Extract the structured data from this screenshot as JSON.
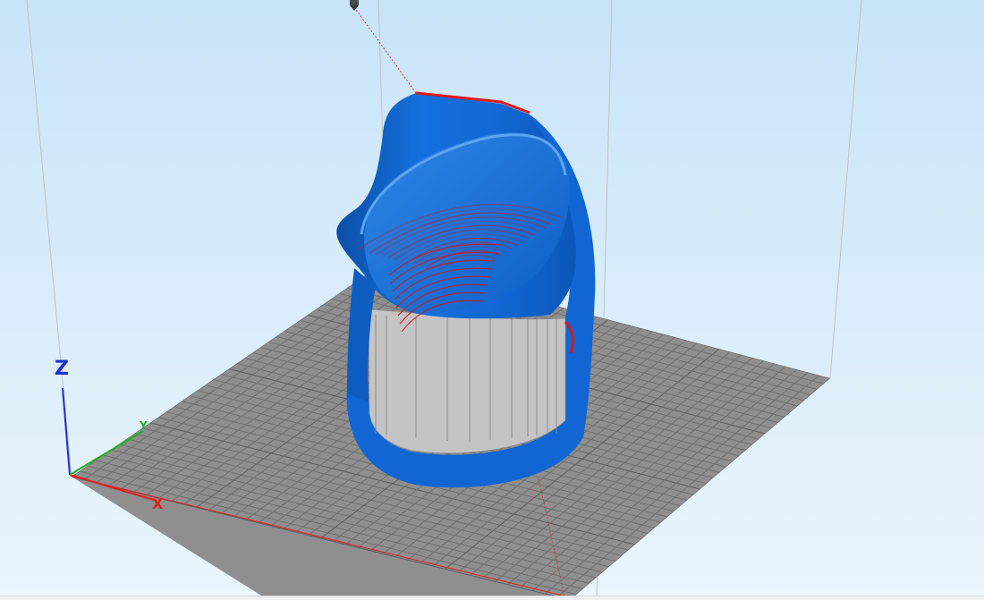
{
  "viewport": {
    "background_top": "#c8e4f8",
    "background_bottom": "#eaf5fc",
    "bed_color": "#8f8f8f",
    "grid_color": "#6e6e6e",
    "frame_line_color": "#bfbfbf",
    "print_color": "#1166d3",
    "print_shadow_color": "#0b4fa8",
    "highlight_color": "#e01818",
    "support_color": "#c4c4c4"
  },
  "axes": {
    "x": {
      "label": "X",
      "color": "#e02020"
    },
    "y": {
      "label": "Y",
      "color": "#20b020"
    },
    "z": {
      "label": "Z",
      "color": "#2030d0"
    }
  },
  "nozzle": {
    "icon": "nozzle-icon"
  }
}
